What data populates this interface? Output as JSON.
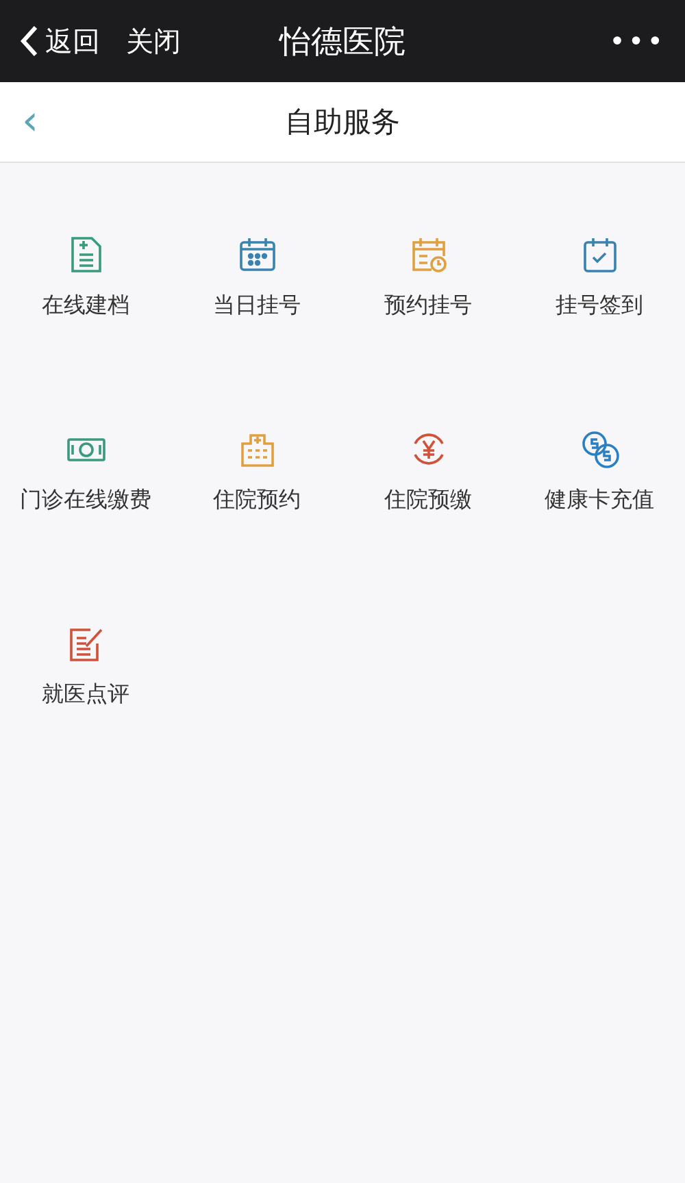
{
  "top_bar": {
    "back": "返回",
    "close": "关闭",
    "title": "怡德医院",
    "more": "•••"
  },
  "header": {
    "back": "‹",
    "title": "自助服务"
  },
  "services": [
    {
      "label": "在线建档",
      "kind": "document",
      "color": "#3a9a7a"
    },
    {
      "label": "当日挂号",
      "kind": "calendar",
      "color": "#3a82b0"
    },
    {
      "label": "预约挂号",
      "kind": "calendar-clock",
      "color": "#e0a040"
    },
    {
      "label": "挂号签到",
      "kind": "calendar-check",
      "color": "#3a82b0"
    },
    {
      "label": "门诊在线缴费",
      "kind": "banknote",
      "color": "#3a9a7a"
    },
    {
      "label": "住院预约",
      "kind": "hospital",
      "color": "#e0a040"
    },
    {
      "label": "住院预缴",
      "kind": "yen",
      "color": "#d0523a"
    },
    {
      "label": "健康卡充值",
      "kind": "coins",
      "color": "#2a80c0"
    },
    {
      "label": "就医点评",
      "kind": "review",
      "color": "#d0523a"
    }
  ]
}
